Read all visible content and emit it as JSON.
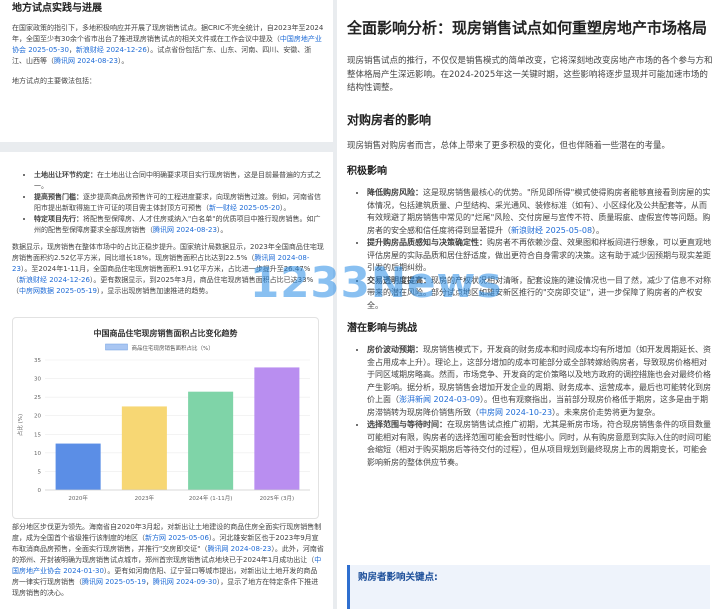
{
  "left_top": {
    "heading": "地方试点实践与进展",
    "para1_a": "在国家政策的指引下，多地积极响应并开展了现房销售试点。据CRIC不完全统计，自2023年至2024年，全国至少有30余个省市出台了推进现房销售试点的相关文件或在工作会议中提及（",
    "para1_link1": "中国房地产业协会 2025-05-30",
    "para1_sep": "，",
    "para1_link2": "新浪财经 2024-12-26",
    "para1_b": "）。试点省份包括广东、山东、河南、四川、安徽、浙江、山西等（",
    "para1_link3": "腾讯网 2024-08-23",
    "para1_c": "）。",
    "para2": "地方试点的主要做法包括："
  },
  "left_bottom": {
    "items": [
      {
        "term": "土地出让环节约定：",
        "text": "在土地出让合同中明确要求项目实行现房销售，这是目前最普遍的方式之一。"
      },
      {
        "term": "提高预售门槛：",
        "text": "逐步提高商品房预售许可的工程进度要求，向现房销售过渡。例如，河南省信阳市提出新取得施工许可证的项目需主体封顶方可预售（",
        "link": "新一财经 2025-05-20",
        "tail": "）。"
      },
      {
        "term": "特定项目先行：",
        "text": "将配售型保障房、人才住房或纳入\"白名单\"的优质项目中推行现房销售。如广州的配售型保障房要求全部现房销售（",
        "link": "腾讯网 2024-08-23",
        "tail": "）。"
      }
    ],
    "para3_a": "数据显示，现房销售在整体市场中的占比正稳步提升。国家统计局数据显示，2023年全国商品住宅现房销售面积约2.52亿平方米，同比增长18%，现房销售面积占比达到22.5%（",
    "para3_link1": "腾讯网 2024-08-23",
    "para3_b": "）。至2024年1-11月，全国商品住宅现房销售面积1.91亿平方米，占比进一步提升至26.47%（",
    "para3_link2": "新浪财经 2024-12-26",
    "para3_c": "）。更有数据显示，到2025年3月，商品住宅现房销售面积占比已达33%（",
    "para3_link3": "中房网数据 2025-05-19",
    "para3_d": "），显示出现房销售加速推进的趋势。",
    "para4_a": "部分地区步伐更为领先。海南省自2020年3月起，对新出让土地建设的商品住房全面实行现房销售制度，成为全国首个省级推行该制度的地区（",
    "para4_link1": "新方网 2025-05-06",
    "para4_b": "）。河北雄安新区也于2023年9月宣布取消商品房预售，全面实行现房销售，并推行\"交房即交证\"（",
    "para4_link2": "腾讯网 2024-08-23",
    "para4_c": "）。此外，河南省的郑州、开封被明确为现房销售试点城市，郑州首宗现房销售试点地块已于2024年1月成功出让（",
    "para4_link3": "中国房地产业协会 2024-01-30",
    "para4_d": "）。更有如河南信阳、辽宁营口等城市提出，对新出让土地开发的商品房一律实行现房销售（",
    "para4_link4": "腾讯网 2025-05-19",
    "para4_e": "，",
    "para4_link5": "腾讯网 2024-09-30",
    "para4_f": "），显示了地方在特定条件下推进现房销售的决心。"
  },
  "chart_data": {
    "type": "bar",
    "title": "中国商品住宅现房销售面积占比变化趋势",
    "legend": "商品住宅现房销售面积占比（%）",
    "categories": [
      "2020年",
      "2023年",
      "2024年 (1-11月)",
      "2025年 (3月)"
    ],
    "values": [
      12.5,
      22.5,
      26.47,
      33
    ],
    "ylabel": "占比 (%)",
    "yticks": [
      "0",
      "5",
      "10",
      "15",
      "20",
      "25",
      "30",
      "35"
    ],
    "ylim": [
      0,
      35
    ],
    "colors": [
      "#5b8ee6",
      "#f7d774",
      "#7fd4a8",
      "#b98ef0"
    ],
    "legend_color": "#a9c6f2"
  },
  "right": {
    "title": "全面影响分析：现房销售试点如何重塑房地产市场格局",
    "intro": "现房销售试点的推行，不仅仅是销售模式的简单改变，它将深刻地改变房地产市场的各个参与方和整体格局产生深远影响。在2024-2025年这一关键时期，这些影响将逐步显现并可能加速市场的结构性调整。",
    "section1": "对购房者的影响",
    "section1_p": "现房销售对购房者而言，总体上带来了更多积极的变化，但也伴随着一些潜在的考量。",
    "positive_title": "积极影响",
    "positive_items": [
      {
        "term": "降低购房风险：",
        "text": "这是现房销售最核心的优势。\"所见即所得\"模式使得购房者能够直接看到房屋的实体情况，包括建筑质量、户型结构、采光通风、装修标准（如有）、小区绿化及公共配套等，从而有效规避了期房销售中常见的\"烂尾\"风险、交付房屋与宣传不符、质量瑕疵、虚假宣传等问题。购房者的安全感和信任度将得到显著提升（",
        "link": "新浪财经 2025-05-08",
        "tail": "）。"
      },
      {
        "term": "提升购房品质感知与决策确定性：",
        "text": "购房者不再依赖沙盘、效果图和样板间进行想象，可以更直观地评估房屋的实际品质和居住舒适度，做出更符合自身需求的决策。这有助于减少因预期与现实差距引发的后期纠纷。"
      },
      {
        "term": "交易透明度提高：",
        "text": "现房的产权状况相对清晰，配套设施的建设情况也一目了然，减少了信息不对称带来的潜在风险。部分试点地区如雄安新区推行的\"交房即交证\"，进一步保障了购房者的产权安全。"
      }
    ],
    "challenge_title": "潜在影响与挑战",
    "challenge_items": [
      {
        "term": "房价波动预期：",
        "text": "现房销售模式下，开发商的财务成本和时间成本均有所增加（如开发周期延长、资金占用成本上升）。理论上，这部分增加的成本可能部分或全部转嫁给购房者，导致现房价格相对于同区域期房略高。然而，市场竞争、开发商的定价策略以及地方政府的调控措施也会对最终价格产生影响。据分析，现房销售会增加开发企业的周期、财务成本、运营成本，最后也可能转化到房价上面（",
        "link": "澎湃新闻 2024-03-09",
        "tail": "）。但也有观察指出，当前部分现房价格低于期房，这多是由于期房滞销转为现房降价销售所致（",
        "link2": "中房网 2024-10-23",
        "tail2": "）。未来房价走势将更为复杂。"
      },
      {
        "term": "选择范围与等待时间：",
        "text": "在现房销售试点推广初期，尤其是新房市场，符合现房销售条件的项目数量可能相对有限，购房者的选择范围可能会暂时性缩小。同时，从有购房意愿到实际入住的时间可能会缩短（相对于购买期房后等待交付的过程），但从项目规划到最终现房上市的周期变长，可能会影响新房的整体供应节奏。"
      }
    ],
    "callout_title": "购房者影响关键点:"
  },
  "watermark": "1233News"
}
